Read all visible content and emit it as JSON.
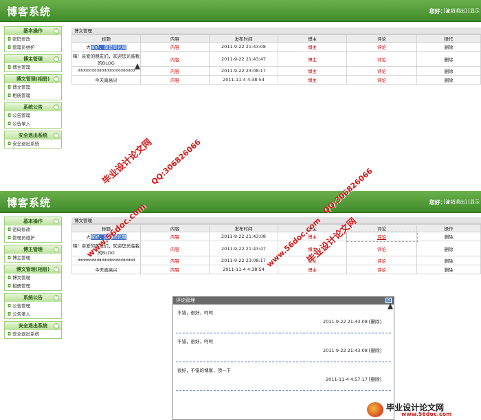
{
  "header": {
    "brand": "博客系统",
    "greeting": "您好：a",
    "links": [
      "[注销退出]",
      "[显示"
    ]
  },
  "sidebar": {
    "groups": [
      {
        "title": "基本操作",
        "items": [
          "密码修改",
          "管理员维护"
        ]
      },
      {
        "title": "博主管理",
        "items": [
          "博主管理"
        ]
      },
      {
        "title": "博文管理(相册)",
        "items": [
          "博文管理",
          "相册管理"
        ]
      },
      {
        "title": "系统公告",
        "items": [
          "公告管理",
          "公告录入"
        ]
      },
      {
        "title": "安全退出系统",
        "items": [
          "安全退出系统"
        ]
      }
    ],
    "toggle_icon": "collapse-chevron-icon"
  },
  "main": {
    "section_title": "博文管理",
    "columns": [
      "标题",
      "内容",
      "发布时间",
      "博主",
      "评论",
      "操作"
    ],
    "rows": [
      {
        "title_prefix": "大",
        "title_highlight": "家好，莫是同光周",
        "content": "内容",
        "time": "2011-9-22 21:43:08",
        "author": "博主",
        "comment": "评论",
        "action": "删除"
      },
      {
        "title": "嗨！亲爱的朋友们，欢迎您光临我的BLOG",
        "content": "内容",
        "time": "2011-9-22 21:43:47",
        "author": "博主",
        "comment": "评论",
        "action": "删除"
      },
      {
        "title": "dddddddddddddddddddddddd",
        "content": "内容",
        "time": "2011-9-22 23:08:17",
        "author": "博主",
        "comment": "评论",
        "action": "删除"
      },
      {
        "title": "今天真高兴",
        "content": "内容",
        "time": "2011-11-4 4:38:54",
        "author": "博主",
        "comment": "评论",
        "action": "删除"
      }
    ]
  },
  "dialog": {
    "title": "评论管理",
    "close_icon": "close-icon",
    "comments": [
      {
        "text": "不错，很好，呵呵",
        "time": "2011-9-22 21:43:08",
        "action": "[删除]"
      },
      {
        "text": "不错，很好，呵呵",
        "time": "2011-9-22 21:43:08",
        "action": "[删除]"
      },
      {
        "text": "很好，不错的博客，顶一下",
        "time": "2011-11-4 4:57:17",
        "action": "[删除]"
      }
    ]
  },
  "watermarks": {
    "site": "www.56doc.com",
    "qq": "QQ:306826066",
    "name": "毕业设计论文网"
  },
  "logo": {
    "title": "毕业设计论文网",
    "url": "www.56doc.com"
  },
  "colors": {
    "header_green": "#4f9a35",
    "accent_red": "#cc0000",
    "selection_blue": "#3f6fc8"
  }
}
